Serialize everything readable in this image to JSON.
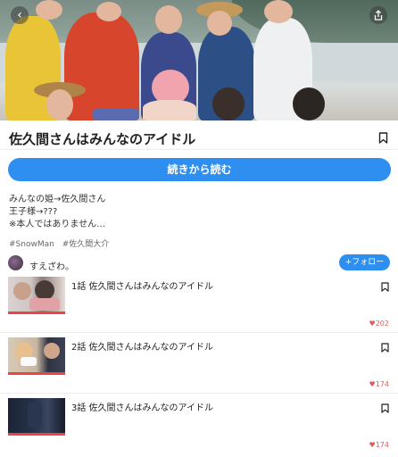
{
  "app": {
    "accent": "#2f8ff0",
    "like_color": "#e05a5a"
  },
  "header": {
    "back_icon": "chevron-left-icon",
    "back_glyph": "‹",
    "share_icon": "share-icon"
  },
  "series": {
    "title": "佐久間さんはみんなのアイドル",
    "read_button_label": "続きから読む",
    "description": "みんなの姫→佐久間さん\n王子様→???\n※本人ではありません…",
    "tags": [
      "#SnowMan",
      "#佐久間大介"
    ]
  },
  "author": {
    "name": "すえざわ。",
    "follow_label": "+フォロー"
  },
  "episodes": [
    {
      "title": "1話 佐久間さんはみんなのアイドル",
      "likes": "♥202"
    },
    {
      "title": "2話 佐久間さんはみんなのアイドル",
      "likes": "♥174"
    },
    {
      "title": "3話 佐久間さんはみんなのアイドル",
      "likes": "♥174"
    }
  ]
}
